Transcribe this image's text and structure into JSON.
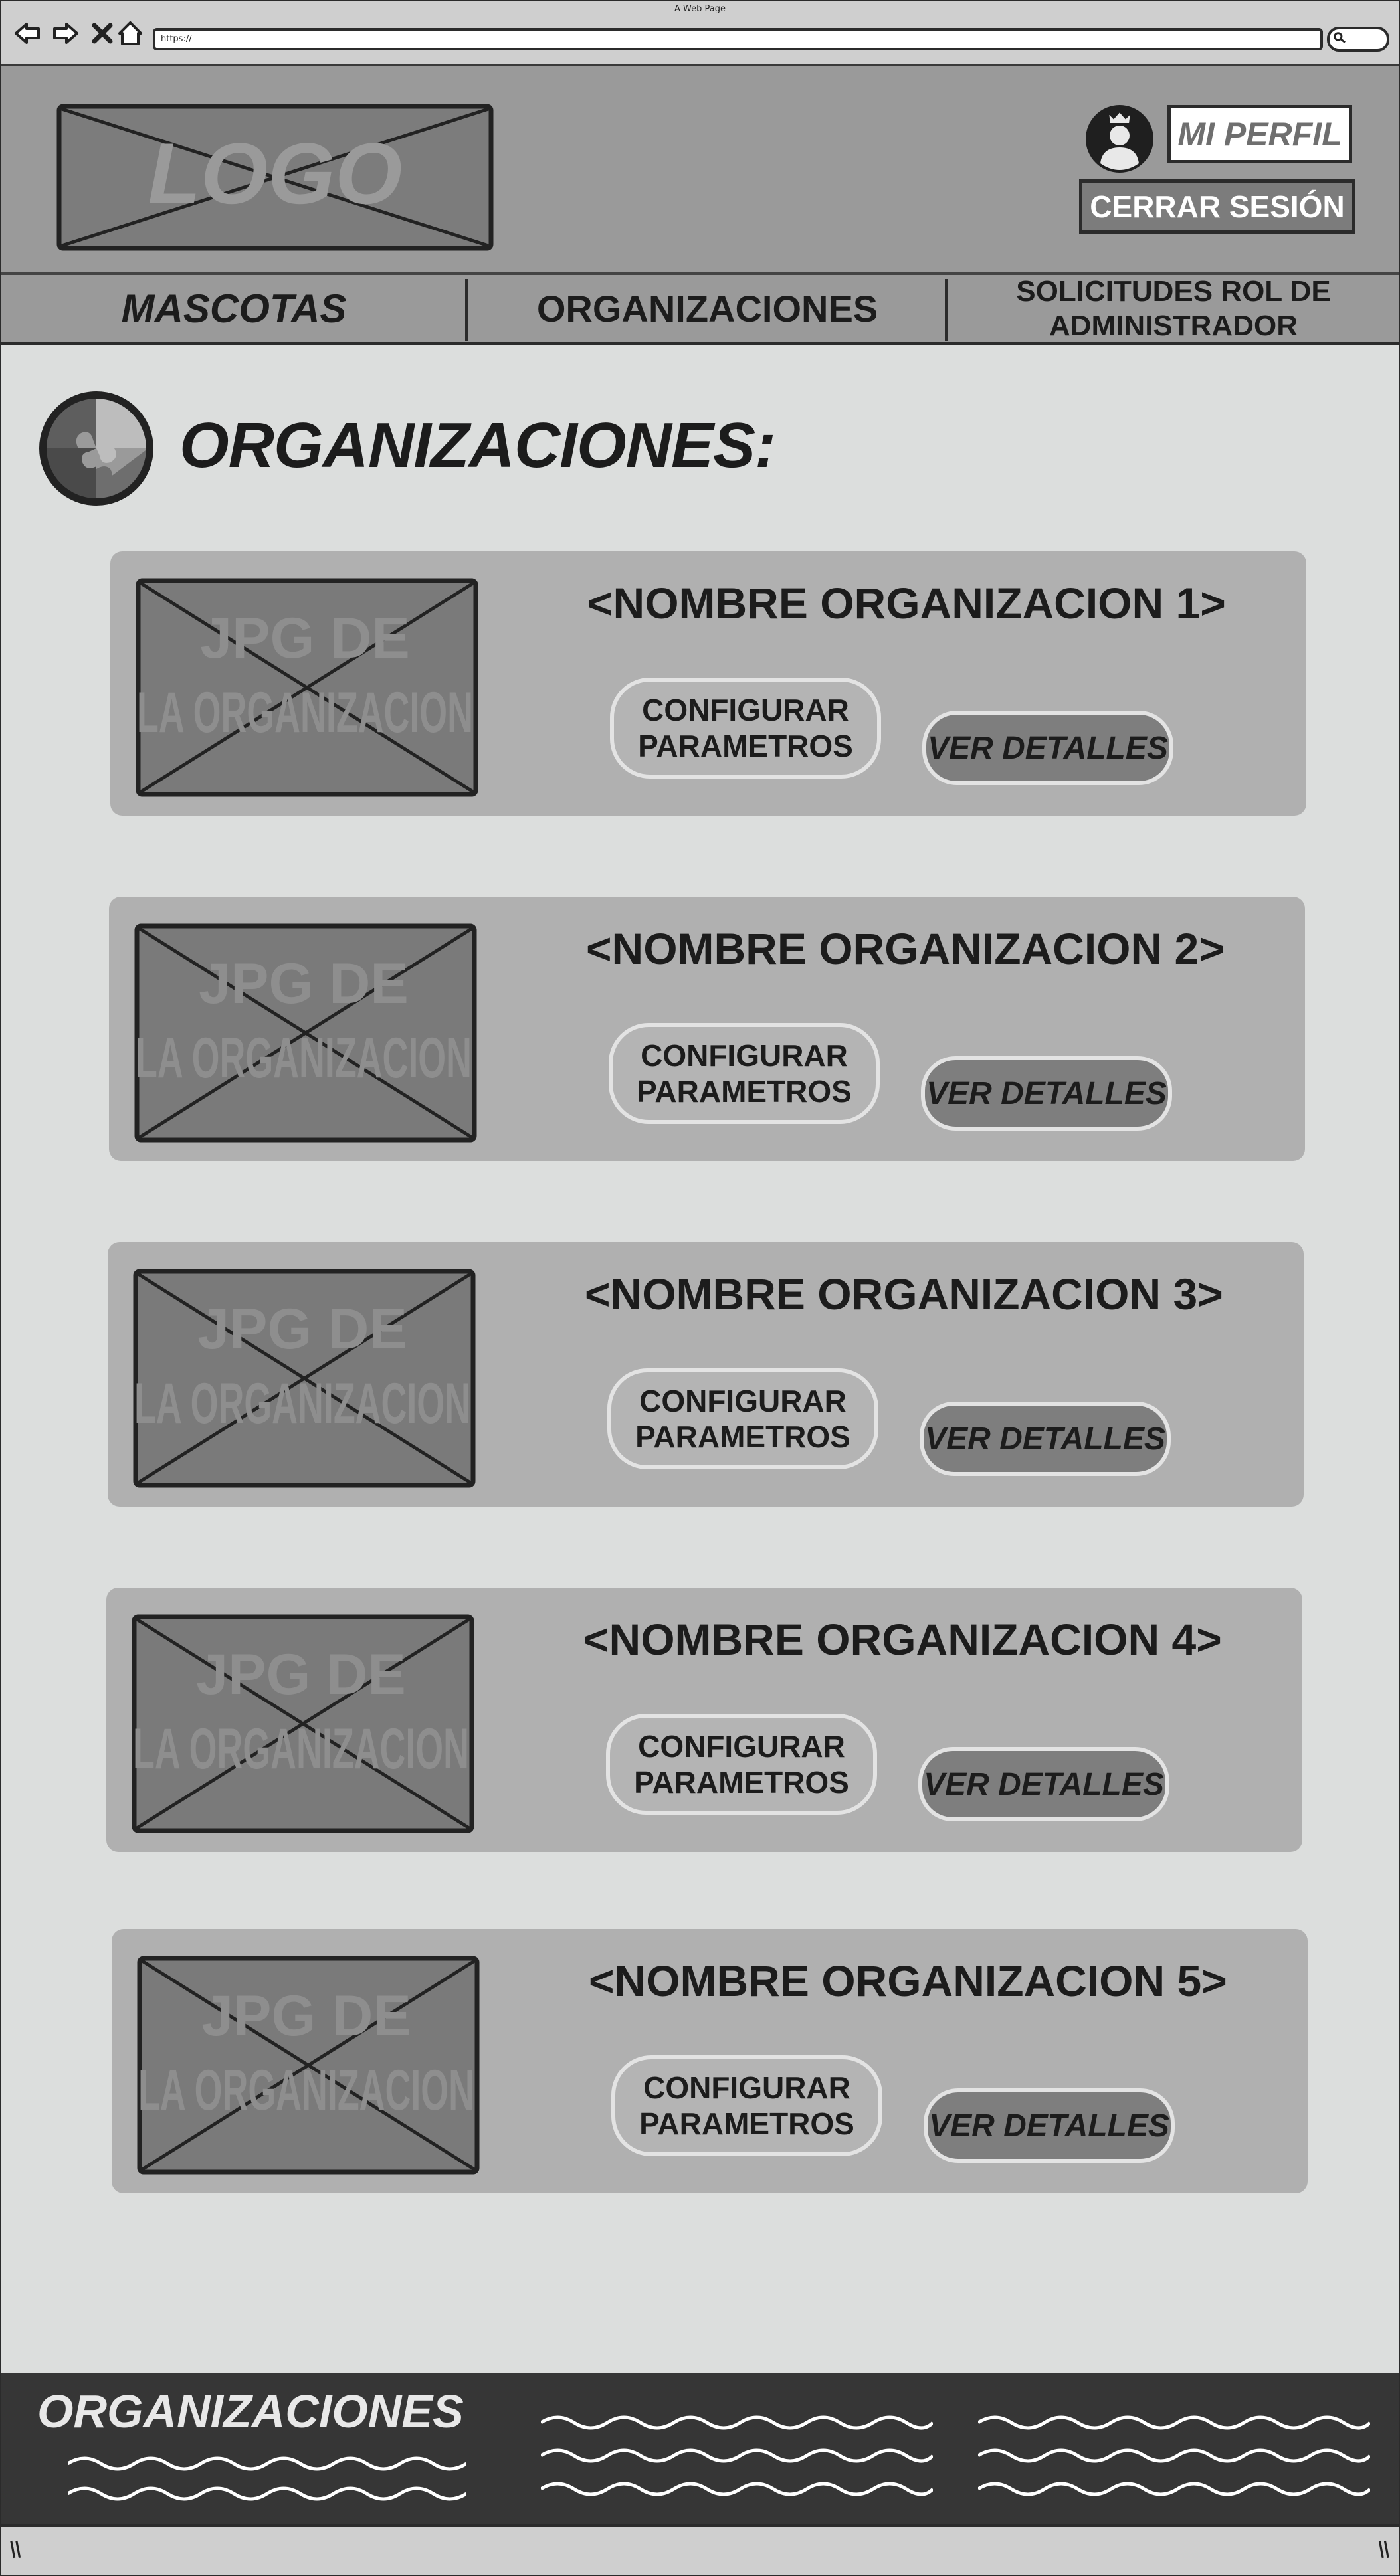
{
  "browser": {
    "window_title": "A Web Page",
    "address": "https://"
  },
  "header": {
    "logo_text": "LOGO",
    "profile_button": "MI PERFIL",
    "logout_button": "CERRAR SESIÓN"
  },
  "nav": {
    "tabs": [
      {
        "label": "MASCOTAS"
      },
      {
        "label": "ORGANIZACIONES"
      },
      {
        "label_line1": "SOLICITUDES ROL DE",
        "label_line2": "ADMINISTRADOR"
      }
    ]
  },
  "main": {
    "title": "ORGANIZACIONES:",
    "cards": [
      {
        "name": "<NOMBRE ORGANIZACION 1>",
        "image_line1": "JPG DE",
        "image_line2": "LA ORGANIZACION",
        "config_line1": "CONFIGURAR",
        "config_line2": "PARAMETROS",
        "details": "VER DETALLES"
      },
      {
        "name": "<NOMBRE ORGANIZACION 2>",
        "image_line1": "JPG DE",
        "image_line2": "LA ORGANIZACION",
        "config_line1": "CONFIGURAR",
        "config_line2": "PARAMETROS",
        "details": "VER DETALLES"
      },
      {
        "name": "<NOMBRE ORGANIZACION 3>",
        "image_line1": "JPG DE",
        "image_line2": "LA ORGANIZACION",
        "config_line1": "CONFIGURAR",
        "config_line2": "PARAMETROS",
        "details": "VER DETALLES"
      },
      {
        "name": "<NOMBRE ORGANIZACION 4>",
        "image_line1": "JPG DE",
        "image_line2": "LA ORGANIZACION",
        "config_line1": "CONFIGURAR",
        "config_line2": "PARAMETROS",
        "details": "VER DETALLES"
      },
      {
        "name": "<NOMBRE ORGANIZACION 5>",
        "image_line1": "JPG DE",
        "image_line2": "LA ORGANIZACION",
        "config_line1": "CONFIGURAR",
        "config_line2": "PARAMETROS",
        "details": "VER DETALLES"
      }
    ]
  },
  "footer": {
    "title": "ORGANIZACIONES"
  },
  "colors": {
    "page_bg": "#dcdedd",
    "header_bg": "#9a9a9a",
    "card_bg": "#b0b0b0",
    "footer_bg": "#363636",
    "dark_button": "#7c7c7c"
  },
  "icons": [
    "back-arrow-icon",
    "forward-arrow-icon",
    "close-icon",
    "home-icon",
    "search-icon",
    "user-avatar-icon",
    "puzzle-icon",
    "image-placeholder-icon",
    "wave-pattern-icon"
  ]
}
